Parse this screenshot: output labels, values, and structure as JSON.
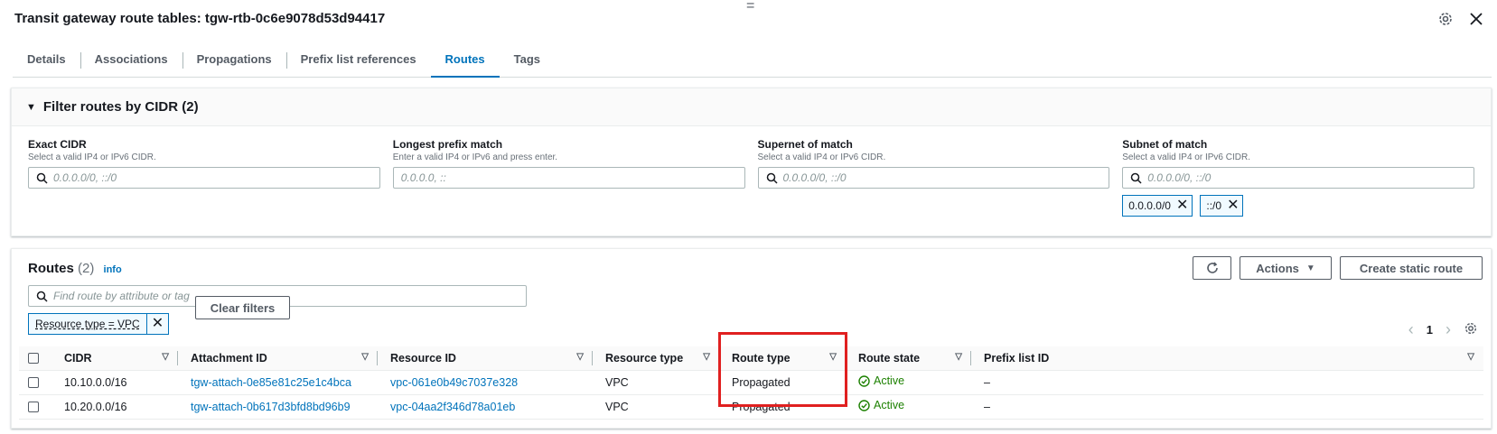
{
  "header": {
    "title": "Transit gateway route tables: tgw-rtb-0c6e9078d53d94417",
    "drag_handle": "="
  },
  "tabs": [
    {
      "label": "Details"
    },
    {
      "label": "Associations"
    },
    {
      "label": "Propagations"
    },
    {
      "label": "Prefix list references"
    },
    {
      "label": "Routes",
      "active": true
    },
    {
      "label": "Tags"
    }
  ],
  "filter": {
    "title": "Filter routes by CIDR (2)",
    "fields": [
      {
        "label": "Exact CIDR",
        "description": "Select a valid IP4 or IPv6 CIDR.",
        "placeholder": "0.0.0.0/0, ::/0"
      },
      {
        "label": "Longest prefix match",
        "description": "Enter a valid IP4 or IPv6 and press enter.",
        "placeholder": "0.0.0.0, ::"
      },
      {
        "label": "Supernet of match",
        "description": "Select a valid IP4 or IPv6 CIDR.",
        "placeholder": "0.0.0.0/0, ::/0"
      },
      {
        "label": "Subnet of match",
        "description": "Select a valid IP4 or IPv6 CIDR.",
        "placeholder": "0.0.0.0/0, ::/0"
      }
    ],
    "tokens": [
      "0.0.0.0/0",
      "::/0"
    ]
  },
  "routes": {
    "title": "Routes",
    "count": "(2)",
    "info": "info",
    "actions_label": "Actions",
    "create_label": "Create static route",
    "search_placeholder": "Find route by attribute or tag",
    "filter_token": "Resource type = VPC",
    "clear_filters": "Clear filters",
    "page": "1",
    "columns": [
      "CIDR",
      "Attachment ID",
      "Resource ID",
      "Resource type",
      "Route type",
      "Route state",
      "Prefix list ID"
    ],
    "rows": [
      {
        "cidr": "10.10.0.0/16",
        "attachment": "tgw-attach-0e85e81c25e1c4bca",
        "resource": "vpc-061e0b49c7037e328",
        "rtype": "VPC",
        "route_type": "Propagated",
        "state": "Active",
        "prefix": "–"
      },
      {
        "cidr": "10.20.0.0/16",
        "attachment": "tgw-attach-0b617d3bfd8bd96b9",
        "resource": "vpc-04aa2f346d78a01eb",
        "rtype": "VPC",
        "route_type": "Propagated",
        "state": "Active",
        "prefix": "–"
      }
    ]
  },
  "colors": {
    "accent": "#0073bb",
    "active": "#1d8102",
    "highlight": "#e02020"
  }
}
